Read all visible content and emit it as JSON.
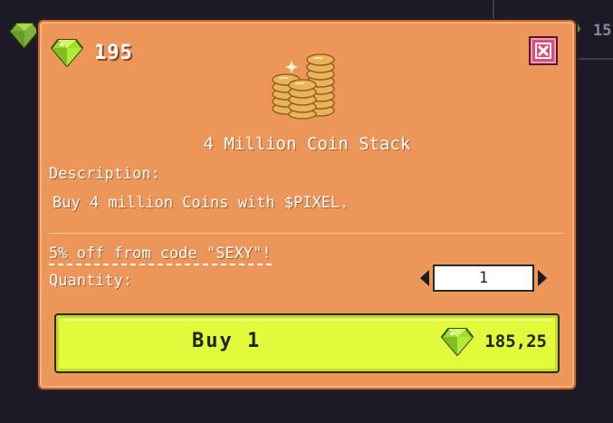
{
  "background": {
    "partial_count": "15",
    "icons": {
      "gem": "gem-icon"
    }
  },
  "modal": {
    "balance": "195",
    "item_title": "4 Million Coin Stack",
    "description_label": "Description:",
    "description_text": "Buy 4 million Coins with $PIXEL.",
    "promo_text": "5% off from code \"SEXY\"!",
    "quantity_label": "Quantity:",
    "quantity_value": "1",
    "buy_label": "Buy 1",
    "price": "185,25",
    "icons": {
      "balance": "gem-icon",
      "close": "close-icon",
      "item": "coin-stack-icon",
      "decrease": "arrow-left-icon",
      "increase": "arrow-right-icon",
      "price": "gem-icon"
    }
  },
  "colors": {
    "panel": "#ec965a",
    "buy_button": "#e1fb3c",
    "close_button": "#d94f7a",
    "gem": "#9adf2a"
  }
}
